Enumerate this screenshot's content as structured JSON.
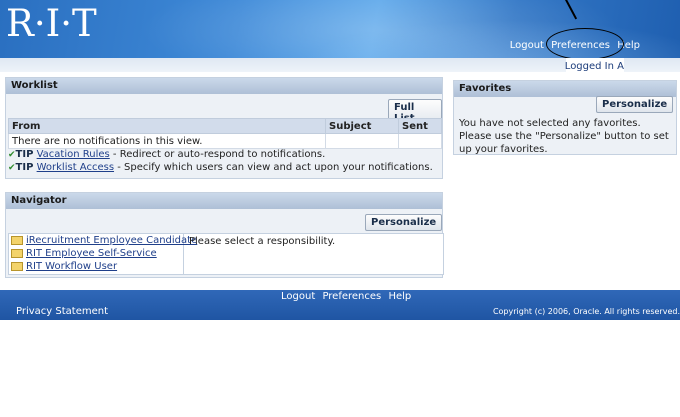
{
  "header": {
    "logo": "R·I·T",
    "links": [
      "Logout",
      "Preferences",
      "Help"
    ],
    "logged_in": "Logged In A"
  },
  "worklist": {
    "title": "Worklist",
    "full_list_button": "Full List",
    "columns": [
      "From",
      "Subject",
      "Sent"
    ],
    "empty_message": "There are no notifications in this view.",
    "tips": [
      {
        "tag": "TIP",
        "link": "Vacation Rules",
        "text": " - Redirect or auto-respond to notifications."
      },
      {
        "tag": "TIP",
        "link": "Worklist Access",
        "text": " - Specify which users can view and act upon your notifications."
      }
    ]
  },
  "navigator": {
    "title": "Navigator",
    "personalize_button": "Personalize",
    "responsibilities": [
      "iRecruitment Employee Candidate",
      "RIT Employee Self-Service",
      "RIT Workflow User"
    ],
    "message": "Please select a responsibility."
  },
  "favorites": {
    "title": "Favorites",
    "personalize_button": "Personalize",
    "message": "You have not selected any favorites. Please use the \"Personalize\" button to set up your favorites."
  },
  "footer": {
    "links": [
      "Logout",
      "Preferences",
      "Help"
    ],
    "privacy": "Privacy Statement",
    "copyright": "Copyright (c) 2006, Oracle. All rights reserved."
  }
}
